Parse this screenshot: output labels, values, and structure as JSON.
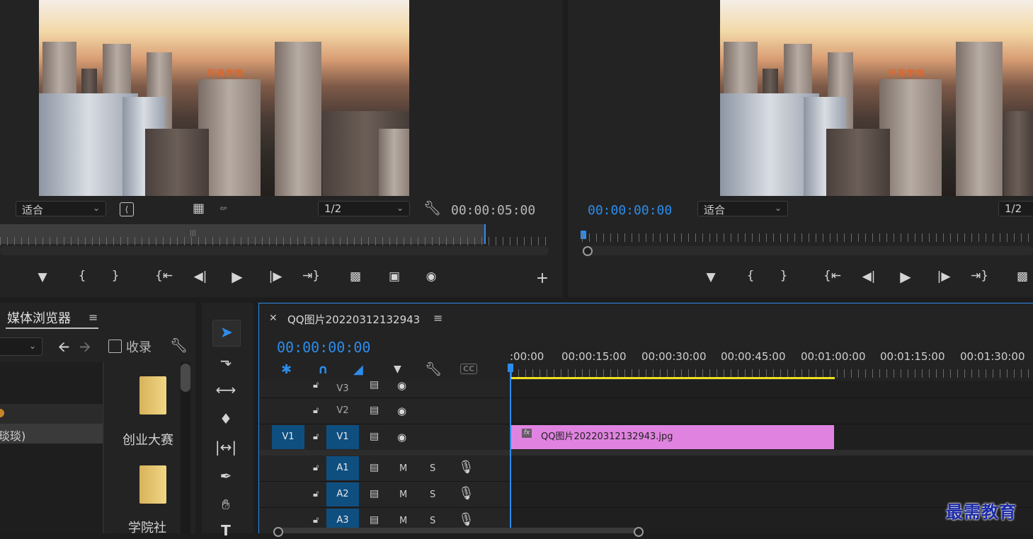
{
  "source_monitor": {
    "fit_label": "适合",
    "resolution_label": "1/2",
    "timecode": "00:00:05:00",
    "sign_text": "环保学院"
  },
  "program_monitor": {
    "timecode": "00:00:00:00",
    "fit_label": "适合",
    "resolution_label": "1/2",
    "sign_text": "环保学院"
  },
  "media_browser": {
    "tab_label": "媒体浏览器",
    "favorite_label": "收录",
    "list_items": [
      "琰琰)"
    ],
    "folders": [
      "创业大赛",
      "学院社"
    ]
  },
  "timeline": {
    "sequence_name": "QQ图片20220312132943",
    "timecode": "00:00:00:00",
    "ruler_labels": [
      ":00:00",
      "00:00:15:00",
      "00:00:30:00",
      "00:00:45:00",
      "00:01:00:00",
      "00:01:15:00",
      "00:01:30:00"
    ],
    "video_tracks": [
      {
        "source": "",
        "label": "V3"
      },
      {
        "source": "",
        "label": "V2"
      },
      {
        "source": "V1",
        "label": "V1"
      }
    ],
    "audio_tracks": [
      {
        "label": "A1",
        "m": "M",
        "s": "S"
      },
      {
        "label": "A2",
        "m": "M",
        "s": "S"
      },
      {
        "label": "A3",
        "m": "M",
        "s": "S"
      }
    ],
    "clip": {
      "name": "QQ图片20220312132943.jpg",
      "fx": "fx",
      "color": "#e083e0"
    },
    "work_area_color": "#f0e020",
    "playhead_color": "#2d8ceb"
  },
  "watermark": "最需教育",
  "colors": {
    "accent": "#2d8ceb",
    "track_selected": "#0f4f80"
  }
}
